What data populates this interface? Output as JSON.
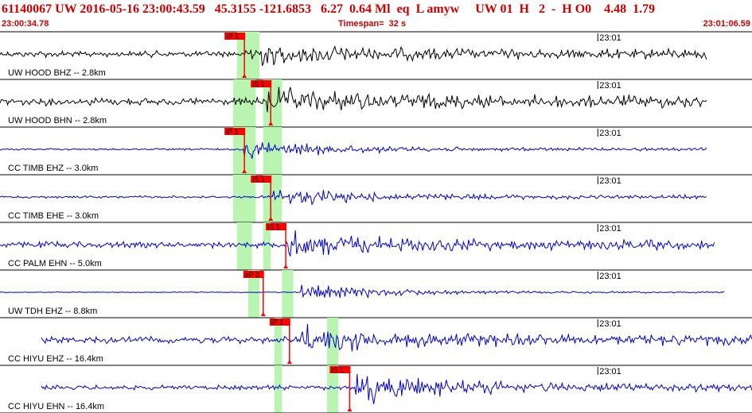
{
  "header": {
    "title": "61140067 UW 2016-05-16 23:00:43.59   45.3155 -121.6853   6.27  0.64 Ml  eq  L amyw     UW 01  H   2  -  H O0    4.48  1.79",
    "start_time": "23:00:34.78",
    "timespan": "Timespan=  32 s",
    "end_time": "23:01:06.59"
  },
  "colors": {
    "title_red": "#cc0000",
    "pick_red": "#ff0000",
    "window_green": "#b9f5b0",
    "trace_black": "#000000",
    "trace_blue": "#0000cc",
    "divider": "#000000"
  },
  "traces": [
    {
      "label": "UW HOOD BHZ -- 2.8km",
      "time_mark": "23:01",
      "color": "black",
      "start": 0.0,
      "end": 0.94,
      "onset": 0.33,
      "noise": 0.2,
      "amp": 0.55,
      "green": [
        0.315,
        0.345
      ],
      "picks": [
        {
          "label": "IP 1",
          "t": 0.325
        }
      ]
    },
    {
      "label": "UW HOOD BHN -- 2.8km",
      "time_mark": "23:01",
      "color": "black",
      "start": 0.0,
      "end": 0.94,
      "onset": 0.355,
      "noise": 0.25,
      "amp": 0.6,
      "green": [
        0.31,
        0.34,
        0.35,
        0.375
      ],
      "picks": [
        {
          "label": "iS 1",
          "t": 0.36
        }
      ]
    },
    {
      "label": "CC TIMB EHZ -- 3.0km",
      "time_mark": "23:01",
      "color": "blue",
      "start": 0.0,
      "end": 0.94,
      "onset": 0.325,
      "noise": 0.06,
      "amp": 0.6,
      "green": [
        0.31,
        0.34,
        0.35,
        0.375
      ],
      "picks": [
        {
          "label": "iP 1",
          "t": 0.325
        }
      ]
    },
    {
      "label": "CC TIMB EHE -- 3.0km",
      "time_mark": "23:01",
      "color": "blue",
      "start": 0.0,
      "end": 0.94,
      "onset": 0.36,
      "noise": 0.08,
      "amp": 0.55,
      "green": [
        0.31,
        0.34,
        0.35,
        0.375
      ],
      "picks": [
        {
          "label": "iS 1",
          "t": 0.36
        }
      ]
    },
    {
      "label": "CC PALM EHN -- 5.0km",
      "time_mark": "23:01",
      "color": "blue",
      "start": 0.0,
      "end": 0.95,
      "onset": 0.38,
      "noise": 0.2,
      "amp": 0.65,
      "green": [
        0.315,
        0.335,
        0.35,
        0.36
      ],
      "picks": [
        {
          "label": "iS 1",
          "t": 0.38
        }
      ]
    },
    {
      "label": "UW TDH EHZ -- 8.8km",
      "time_mark": "23:01",
      "color": "blue",
      "start": 0.0,
      "end": 0.965,
      "onset": 0.4,
      "noise": 0.03,
      "amp": 0.55,
      "green": [
        0.33,
        0.345,
        0.375,
        0.39
      ],
      "picks": [
        {
          "label": "eP 2",
          "t": 0.35
        }
      ]
    },
    {
      "label": "CC HIYU EHZ -- 16.4km",
      "time_mark": "23:01",
      "color": "blue",
      "start": 0.055,
      "end": 1.0,
      "onset": 0.4,
      "noise": 0.22,
      "amp": 0.75,
      "green": [
        0.365,
        0.375,
        0.435,
        0.45
      ],
      "picks": [
        {
          "label": "iP 1",
          "t": 0.385
        }
      ]
    },
    {
      "label": "CC HIYU EHN -- 16.4km",
      "time_mark": "23:01",
      "color": "blue",
      "start": 0.055,
      "end": 1.0,
      "onset": 0.47,
      "noise": 0.15,
      "amp": 0.9,
      "green": [
        0.365,
        0.375,
        0.435,
        0.45
      ],
      "picks": [
        {
          "label": "iS 1",
          "t": 0.465
        }
      ]
    }
  ]
}
